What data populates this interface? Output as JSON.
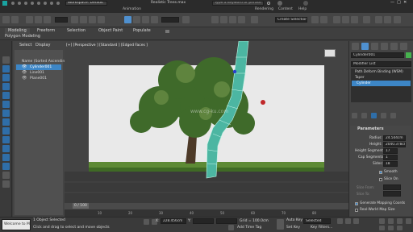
{
  "title_bar": {
    "workspace_label": "Workspace: Default",
    "file_name": "Realistic Trees.max",
    "search_placeholder": "Type a keyword or phrase"
  },
  "menu_fragments": {
    "animation": "Animation",
    "render": "Rendering",
    "content": "Content",
    "help": "Help"
  },
  "selection_set_label": "Create Selection Se",
  "ribbon": {
    "tabs": [
      "Modeling",
      "Freeform",
      "Selection",
      "Object Paint",
      "Populate"
    ],
    "subpanel": "Polygon Modeling"
  },
  "scene_explorer": {
    "tabs": [
      "Select",
      "Display"
    ],
    "header": "Name (Sorted Ascending)",
    "items": [
      "Cylinder001",
      "Line001",
      "Plane001"
    ]
  },
  "viewport": {
    "label": "[+] [Perspective ] [Standard ] [Edged Faces ]",
    "watermark": "www.cg-ku.com",
    "timeline": {
      "current": "0 / 100"
    }
  },
  "command_panel": {
    "object_name": "Cylinder001",
    "modifier_list_label": "Modifier List",
    "stack": [
      "Path Deform Binding (WSM)",
      "Taper",
      "Cylinder"
    ],
    "parameters_title": "Parameters",
    "params": [
      {
        "label": "Radius:",
        "value": "24.504cm"
      },
      {
        "label": "Height:",
        "value": "2040.378cl"
      },
      {
        "label": "Height Segments:",
        "value": "17"
      },
      {
        "label": "Cap Segments:",
        "value": "1"
      },
      {
        "label": "Sides:",
        "value": "18"
      }
    ],
    "smooth_label": "Smooth",
    "slice_on_label": "Slice On",
    "slice_from_label": "Slice From:",
    "slice_to_label": "Slice To:",
    "gen_mapping_label": "Generate Mapping Coords",
    "real_world_label": "Real-World Map Size"
  },
  "status": {
    "maxscript_placeholder": "Welcome to M",
    "selection": "1 Object Selected",
    "prompt": "Click and drag to select and move objects",
    "x_label": "X:",
    "x_value": "228.456cm",
    "y_label": "Y:",
    "grid": "Grid = 100.0cm",
    "add_time_tag": "Add Time Tag",
    "auto_key": "Auto Key",
    "set_key": "Set Key",
    "selected": "Selected",
    "key_filters": "Key Filters..."
  },
  "timeline_ticks": [
    "10",
    "20",
    "30",
    "40",
    "50",
    "60",
    "70",
    "80"
  ],
  "colors": {
    "accent_blue": "#2f7cc7",
    "selection_blue": "#3d86c6",
    "teal": "#7ddad0"
  },
  "icons": [
    "undo-icon",
    "redo-icon",
    "link-icon",
    "unlink-icon",
    "bind-space-warp-icon",
    "selection-filter-icon",
    "select-icon",
    "select-by-name-icon",
    "rect-select-icon",
    "window-crossing-icon",
    "move-icon",
    "rotate-icon",
    "scale-icon",
    "snap-icon",
    "angle-snap-icon",
    "percent-snap-icon",
    "render-setup-icon",
    "render-icon",
    "search-icon",
    "sign-in-icon",
    "help-icon",
    "play-icon",
    "zoom-icon",
    "pan-icon",
    "orbit-icon",
    "maximize-icon"
  ]
}
